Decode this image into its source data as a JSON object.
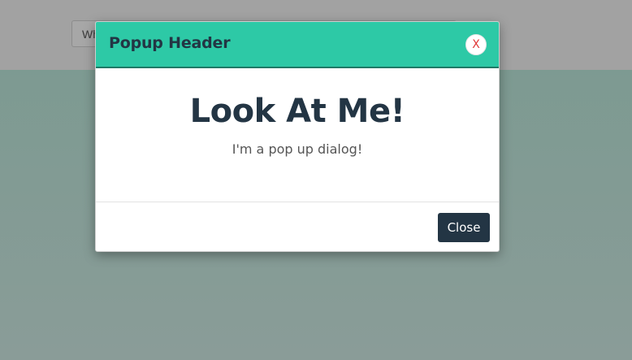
{
  "background": {
    "search_input": {
      "value": "Wh",
      "placeholder": ""
    }
  },
  "modal": {
    "header_title": "Popup Header",
    "close_icon_label": "X",
    "heading": "Look At Me!",
    "message": "I'm a pop up dialog!",
    "close_button_label": "Close"
  },
  "colors": {
    "header_bg": "#2dc9a6",
    "header_text": "#233544",
    "close_icon": "#e03a3a",
    "button_bg": "#233544",
    "overlay_top": "#a2a2a2",
    "overlay_bottom": "#7a9a90"
  },
  "icons": {
    "close": "close-icon"
  }
}
